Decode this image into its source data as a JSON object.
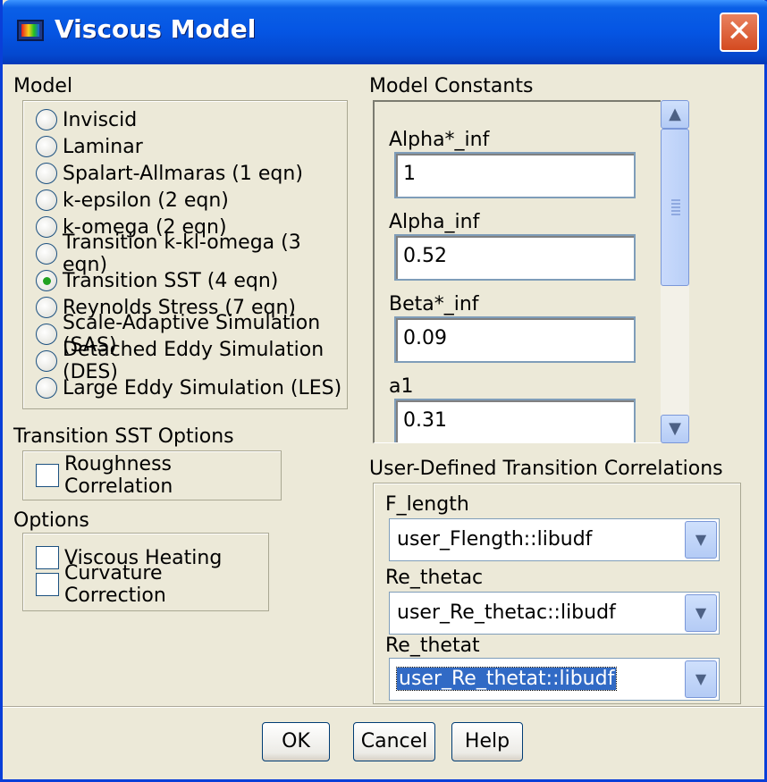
{
  "window": {
    "title": "Viscous Model",
    "close_glyph": "✕"
  },
  "model": {
    "label": "Model",
    "options": [
      {
        "label": "Inviscid",
        "checked": false
      },
      {
        "label": "Laminar",
        "checked": false
      },
      {
        "label": "Spalart-Allmaras (1 eqn)",
        "checked": false
      },
      {
        "label": "k-epsilon (2 eqn)",
        "checked": false
      },
      {
        "label": "k-omega (2 eqn)",
        "checked": false
      },
      {
        "label": "Transition k-kl-omega (3 eqn)",
        "checked": false
      },
      {
        "label": "Transition SST (4 eqn)",
        "checked": true
      },
      {
        "label": "Reynolds Stress (7 eqn)",
        "checked": false
      },
      {
        "label": "Scale-Adaptive Simulation (SAS)",
        "checked": false
      },
      {
        "label": "Detached Eddy Simulation (DES)",
        "checked": false
      },
      {
        "label": "Large Eddy Simulation (LES)",
        "checked": false
      }
    ]
  },
  "transition_options": {
    "label": "Transition SST Options",
    "roughness_label": "Roughness Correlation",
    "roughness_checked": false
  },
  "options": {
    "label": "Options",
    "viscous_heating_label": "Viscous Heating",
    "viscous_heating_checked": false,
    "curvature_label": "Curvature Correction",
    "curvature_checked": false
  },
  "model_constants": {
    "label": "Model Constants",
    "items": [
      {
        "label": "Alpha*_inf",
        "value": "1"
      },
      {
        "label": "Alpha_inf",
        "value": "0.52"
      },
      {
        "label": "Beta*_inf",
        "value": "0.09"
      },
      {
        "label": "a1",
        "value": "0.31"
      }
    ],
    "scroll_up_glyph": "▲",
    "scroll_down_glyph": "▼"
  },
  "udf": {
    "label": "User-Defined Transition Correlations",
    "fields": [
      {
        "label": "F_length",
        "value": "user_Flength::libudf"
      },
      {
        "label": "Re_thetac",
        "value": "user_Re_thetac::libudf"
      },
      {
        "label": "Re_thetat",
        "value": "user_Re_thetat::libudf"
      }
    ],
    "dropdown_glyph": "▼"
  },
  "buttons": {
    "ok": "OK",
    "cancel": "Cancel",
    "help": "Help"
  },
  "colors": {
    "title_bar": "#0555e3",
    "dialog_bg": "#ece9d8",
    "selection": "#316ac5",
    "radio_dot": "#21a121",
    "close": "#d44a20"
  }
}
